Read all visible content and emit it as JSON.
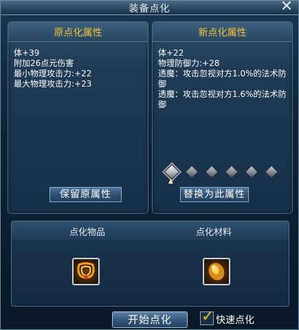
{
  "window": {
    "title": "装备点化",
    "close_icon": "close-icon"
  },
  "original_panel": {
    "title": "原点化属性",
    "attributes": [
      "体+39",
      "附加26点元伤害",
      "最小物理攻击力:+22",
      "最大物理攻击力:+23"
    ],
    "keep_label": "保留原属性"
  },
  "new_panel": {
    "title": "新点化属性",
    "attributes": [
      "体+22",
      "物理防御力:+28",
      "透魔：攻击忽视对方1.0%的法术防御",
      "透魔：攻击忽视对方1.6%的法术防御"
    ],
    "replace_label": "替换为此属性",
    "slots_total": 6,
    "slot_selected": 1
  },
  "bottom": {
    "item_label": "点化物品",
    "material_label": "点化材料",
    "item_icon": "necklace-icon",
    "material_icon": "gem-icon"
  },
  "start_label": "开始点化",
  "quick_label": "快速点化",
  "quick_checked": true,
  "colors": {
    "accent_title": "#f0c33a",
    "text": "#ffffff"
  }
}
